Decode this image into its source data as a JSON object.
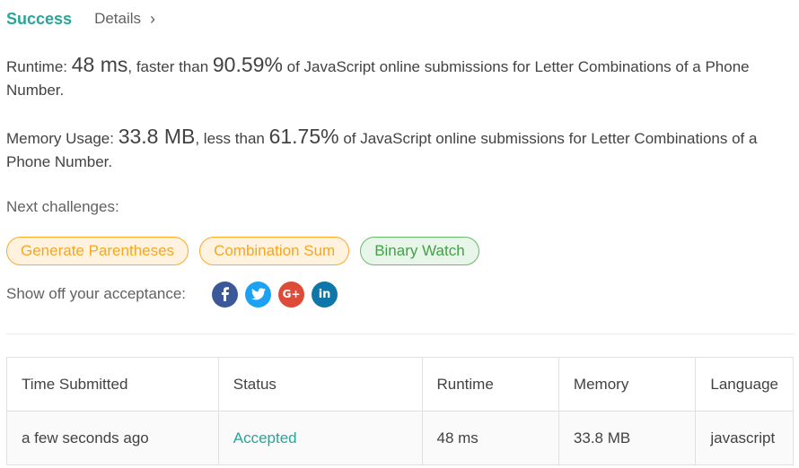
{
  "header": {
    "status": "Success",
    "details": "Details"
  },
  "runtime": {
    "label": "Runtime: ",
    "value": "48 ms",
    "mid": ", faster than ",
    "percent": "90.59%",
    "tail": " of JavaScript online submissions for Letter Combinations of a Phone Number."
  },
  "memory": {
    "label": "Memory Usage: ",
    "value": "33.8 MB",
    "mid": ", less than ",
    "percent": "61.75%",
    "tail": " of JavaScript online submissions for Letter Combinations of a Phone Number."
  },
  "next": {
    "label": "Next challenges:",
    "items": [
      {
        "label": "Generate Parentheses",
        "difficulty": "medium"
      },
      {
        "label": "Combination Sum",
        "difficulty": "medium"
      },
      {
        "label": "Binary Watch",
        "difficulty": "easy"
      }
    ]
  },
  "share": {
    "label": "Show off your acceptance:",
    "icons": [
      "facebook-icon",
      "twitter-icon",
      "google-plus-icon",
      "linkedin-icon"
    ]
  },
  "table": {
    "headers": [
      "Time Submitted",
      "Status",
      "Runtime",
      "Memory",
      "Language"
    ],
    "rows": [
      [
        "a few seconds ago",
        "Accepted",
        "48 ms",
        "33.8 MB",
        "javascript"
      ]
    ]
  },
  "colors": {
    "accent": "#26a69a",
    "medium_chip": "#f5a623",
    "easy_chip": "#43a047",
    "facebook": "#3b5998",
    "twitter": "#1da1f2",
    "google_plus": "#dd4b39",
    "linkedin": "#0e76a8"
  }
}
